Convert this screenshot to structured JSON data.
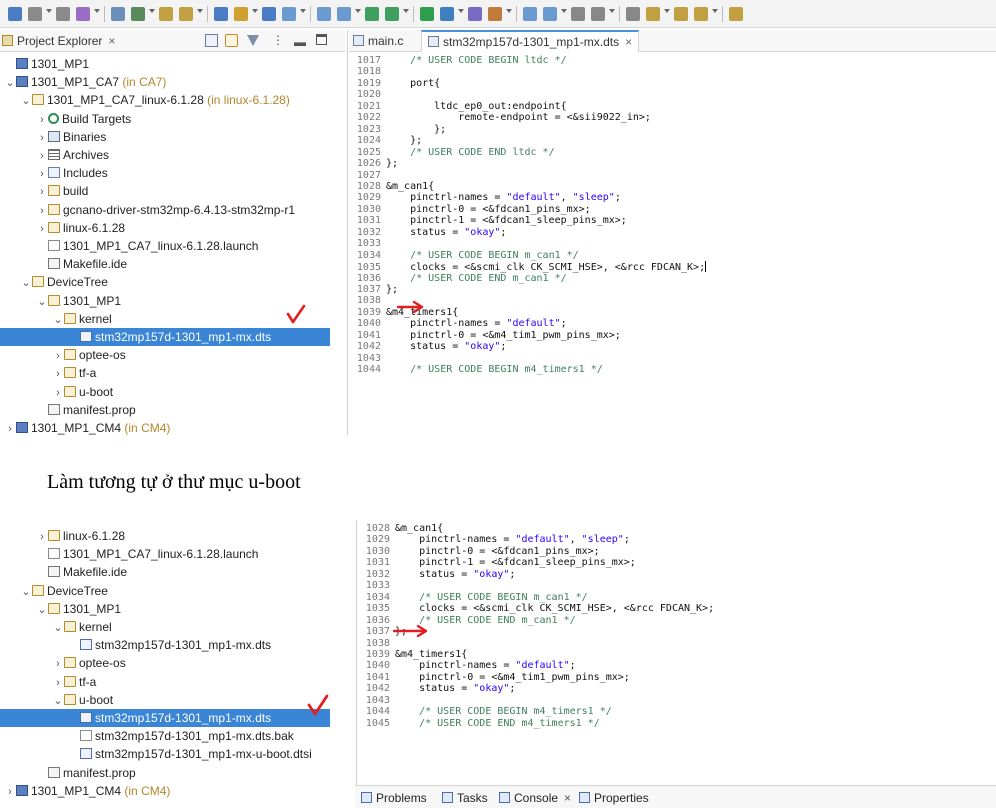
{
  "toolbar": {
    "buttons": [
      "new-icon",
      "save-icon",
      "save-all-icon",
      "debug-icon",
      "tools-icon",
      "build-icon",
      "back-icon",
      "forward-icon",
      "search-icon",
      "debug-run-icon",
      "target-icon",
      "new-project-icon",
      "new-file-icon",
      "new-class-icon",
      "refresh-icon",
      "bug-icon",
      "run-icon",
      "tools-run-icon",
      "external-icon",
      "pen-icon",
      "open-type-icon",
      "palette-icon",
      "format-icon",
      "next-annotation-icon",
      "prev-annotation-icon",
      "back-nav-icon",
      "forward-nav-icon",
      "history-back-icon",
      "history-fwd-icon"
    ]
  },
  "top": {
    "explorer": {
      "tab_label": "Project Explorer",
      "rows": [
        {
          "indent": 0,
          "twisty": "",
          "icon": "ico-project",
          "label": "1301_MP1",
          "suffix": ""
        },
        {
          "indent": 0,
          "twisty": "v",
          "icon": "ico-project",
          "label": "1301_MP1_CA7",
          "suffix": " (in CA7)"
        },
        {
          "indent": 1,
          "twisty": "v",
          "icon": "ico-folder",
          "label": "1301_MP1_CA7_linux-6.1.28",
          "suffix": " (in linux-6.1.28)"
        },
        {
          "indent": 2,
          "twisty": ">",
          "icon": "ico-target",
          "label": "Build Targets",
          "suffix": ""
        },
        {
          "indent": 2,
          "twisty": ">",
          "icon": "ico-bin",
          "label": "Binaries",
          "suffix": ""
        },
        {
          "indent": 2,
          "twisty": ">",
          "icon": "ico-arch",
          "label": "Archives",
          "suffix": ""
        },
        {
          "indent": 2,
          "twisty": ">",
          "icon": "ico-inc",
          "label": "Includes",
          "suffix": ""
        },
        {
          "indent": 2,
          "twisty": ">",
          "icon": "ico-folder",
          "label": "build",
          "suffix": ""
        },
        {
          "indent": 2,
          "twisty": ">",
          "icon": "ico-folder",
          "label": "gcnano-driver-stm32mp-6.4.13-stm32mp-r1",
          "suffix": ""
        },
        {
          "indent": 2,
          "twisty": ">",
          "icon": "ico-folder",
          "label": "linux-6.1.28",
          "suffix": ""
        },
        {
          "indent": 2,
          "twisty": "",
          "icon": "ico-file",
          "label": "1301_MP1_CA7_linux-6.1.28.launch",
          "suffix": ""
        },
        {
          "indent": 2,
          "twisty": "",
          "icon": "ico-mk",
          "label": "Makefile.ide",
          "suffix": ""
        },
        {
          "indent": 1,
          "twisty": "v",
          "icon": "ico-folder",
          "label": "DeviceTree",
          "suffix": ""
        },
        {
          "indent": 2,
          "twisty": "v",
          "icon": "ico-folder",
          "label": "1301_MP1",
          "suffix": ""
        },
        {
          "indent": 3,
          "twisty": "v",
          "icon": "ico-folder",
          "label": "kernel",
          "suffix": ""
        },
        {
          "indent": 4,
          "twisty": "",
          "icon": "ico-dts",
          "label": "stm32mp157d-1301_mp1-mx.dts",
          "suffix": "",
          "selected": true
        },
        {
          "indent": 3,
          "twisty": ">",
          "icon": "ico-folder",
          "label": "optee-os",
          "suffix": ""
        },
        {
          "indent": 3,
          "twisty": ">",
          "icon": "ico-folder",
          "label": "tf-a",
          "suffix": ""
        },
        {
          "indent": 3,
          "twisty": ">",
          "icon": "ico-folder",
          "label": "u-boot",
          "suffix": ""
        },
        {
          "indent": 2,
          "twisty": "",
          "icon": "ico-mk",
          "label": "manifest.prop",
          "suffix": ""
        },
        {
          "indent": 0,
          "twisty": ">",
          "icon": "ico-project",
          "label": "1301_MP1_CM4",
          "suffix": " (in CM4)"
        }
      ]
    },
    "editor": {
      "tabs": [
        {
          "label": "main.c",
          "active": false
        },
        {
          "label": "stm32mp157d-1301_mp1-mx.dts",
          "active": true
        }
      ],
      "lines": [
        {
          "n": "1017",
          "segs": [
            {
              "t": "    "
            },
            {
              "t": "/* USER CODE BEGIN ltdc */",
              "c": "cm"
            }
          ]
        },
        {
          "n": "1018",
          "segs": []
        },
        {
          "n": "1019",
          "segs": [
            {
              "t": "    port{"
            }
          ]
        },
        {
          "n": "1020",
          "segs": []
        },
        {
          "n": "1021",
          "segs": [
            {
              "t": "        ltdc_ep0_out:endpoint{"
            }
          ]
        },
        {
          "n": "1022",
          "segs": [
            {
              "t": "            remote-endpoint = <&sii9022_in>;"
            }
          ]
        },
        {
          "n": "1023",
          "segs": [
            {
              "t": "        };"
            }
          ]
        },
        {
          "n": "1024",
          "segs": [
            {
              "t": "    };"
            }
          ]
        },
        {
          "n": "1025",
          "segs": [
            {
              "t": "    "
            },
            {
              "t": "/* USER CODE END ltdc */",
              "c": "cm"
            }
          ]
        },
        {
          "n": "1026",
          "segs": [
            {
              "t": "};"
            }
          ]
        },
        {
          "n": "1027",
          "segs": []
        },
        {
          "n": "1028",
          "segs": [
            {
              "t": "&m_can1{"
            }
          ]
        },
        {
          "n": "1029",
          "segs": [
            {
              "t": "    pinctrl-names = "
            },
            {
              "t": "\"default\"",
              "c": "st"
            },
            {
              "t": ", "
            },
            {
              "t": "\"sleep\"",
              "c": "st"
            },
            {
              "t": ";"
            }
          ]
        },
        {
          "n": "1030",
          "segs": [
            {
              "t": "    pinctrl-0 = <&fdcan1_pins_mx>;"
            }
          ]
        },
        {
          "n": "1031",
          "segs": [
            {
              "t": "    pinctrl-1 = <&fdcan1_sleep_pins_mx>;"
            }
          ]
        },
        {
          "n": "1032",
          "segs": [
            {
              "t": "    status = "
            },
            {
              "t": "\"okay\"",
              "c": "st"
            },
            {
              "t": ";"
            }
          ]
        },
        {
          "n": "1033",
          "segs": []
        },
        {
          "n": "1034",
          "segs": [
            {
              "t": "    "
            },
            {
              "t": "/* USER CODE BEGIN m_can1 */",
              "c": "cm"
            }
          ]
        },
        {
          "n": "1035",
          "segs": [
            {
              "t": "    clocks = <&scmi_clk CK_SCMI_HSE>, <&rcc FDCAN_K>;"
            }
          ],
          "caret": true
        },
        {
          "n": "1036",
          "segs": [
            {
              "t": "    "
            },
            {
              "t": "/* USER CODE END m_can1 */",
              "c": "cm"
            }
          ]
        },
        {
          "n": "1037",
          "segs": [
            {
              "t": "};"
            }
          ]
        },
        {
          "n": "1038",
          "segs": []
        },
        {
          "n": "1039",
          "segs": [
            {
              "t": "&m4_timers1{"
            }
          ]
        },
        {
          "n": "1040",
          "segs": [
            {
              "t": "    pinctrl-names = "
            },
            {
              "t": "\"default\"",
              "c": "st"
            },
            {
              "t": ";"
            }
          ]
        },
        {
          "n": "1041",
          "segs": [
            {
              "t": "    pinctrl-0 = <&m4_tim1_pwm_pins_mx>;"
            }
          ]
        },
        {
          "n": "1042",
          "segs": [
            {
              "t": "    status = "
            },
            {
              "t": "\"okay\"",
              "c": "st"
            },
            {
              "t": ";"
            }
          ]
        },
        {
          "n": "1043",
          "segs": []
        },
        {
          "n": "1044",
          "segs": [
            {
              "t": "    "
            },
            {
              "t": "/* USER CODE BEGIN m4_timers1 */",
              "c": "cm"
            }
          ]
        }
      ]
    }
  },
  "caption": "Làm tương tự ở thư mục u-boot",
  "bottom": {
    "explorer": {
      "rows": [
        {
          "indent": 2,
          "twisty": ">",
          "icon": "ico-folder",
          "label": "linux-6.1.28",
          "suffix": ""
        },
        {
          "indent": 2,
          "twisty": "",
          "icon": "ico-file",
          "label": "1301_MP1_CA7_linux-6.1.28.launch",
          "suffix": ""
        },
        {
          "indent": 2,
          "twisty": "",
          "icon": "ico-mk",
          "label": "Makefile.ide",
          "suffix": ""
        },
        {
          "indent": 1,
          "twisty": "v",
          "icon": "ico-folder",
          "label": "DeviceTree",
          "suffix": ""
        },
        {
          "indent": 2,
          "twisty": "v",
          "icon": "ico-folder",
          "label": "1301_MP1",
          "suffix": ""
        },
        {
          "indent": 3,
          "twisty": "v",
          "icon": "ico-folder",
          "label": "kernel",
          "suffix": ""
        },
        {
          "indent": 4,
          "twisty": "",
          "icon": "ico-dts",
          "label": "stm32mp157d-1301_mp1-mx.dts",
          "suffix": ""
        },
        {
          "indent": 3,
          "twisty": ">",
          "icon": "ico-folder",
          "label": "optee-os",
          "suffix": ""
        },
        {
          "indent": 3,
          "twisty": ">",
          "icon": "ico-folder",
          "label": "tf-a",
          "suffix": ""
        },
        {
          "indent": 3,
          "twisty": "v",
          "icon": "ico-folder",
          "label": "u-boot",
          "suffix": ""
        },
        {
          "indent": 4,
          "twisty": "",
          "icon": "ico-dts",
          "label": "stm32mp157d-1301_mp1-mx.dts",
          "suffix": "",
          "selected": true
        },
        {
          "indent": 4,
          "twisty": "",
          "icon": "ico-file",
          "label": "stm32mp157d-1301_mp1-mx.dts.bak",
          "suffix": ""
        },
        {
          "indent": 4,
          "twisty": "",
          "icon": "ico-dts",
          "label": "stm32mp157d-1301_mp1-mx-u-boot.dtsi",
          "suffix": ""
        },
        {
          "indent": 2,
          "twisty": "",
          "icon": "ico-mk",
          "label": "manifest.prop",
          "suffix": ""
        },
        {
          "indent": 0,
          "twisty": ">",
          "icon": "ico-project",
          "label": "1301_MP1_CM4",
          "suffix": " (in CM4)"
        }
      ]
    },
    "editor": {
      "lines": [
        {
          "n": "1028",
          "segs": [
            {
              "t": "&m_can1{"
            }
          ]
        },
        {
          "n": "1029",
          "segs": [
            {
              "t": "    pinctrl-names = "
            },
            {
              "t": "\"default\"",
              "c": "st"
            },
            {
              "t": ", "
            },
            {
              "t": "\"sleep\"",
              "c": "st"
            },
            {
              "t": ";"
            }
          ]
        },
        {
          "n": "1030",
          "segs": [
            {
              "t": "    pinctrl-0 = <&fdcan1_pins_mx>;"
            }
          ]
        },
        {
          "n": "1031",
          "segs": [
            {
              "t": "    pinctrl-1 = <&fdcan1_sleep_pins_mx>;"
            }
          ]
        },
        {
          "n": "1032",
          "segs": [
            {
              "t": "    status = "
            },
            {
              "t": "\"okay\"",
              "c": "st"
            },
            {
              "t": ";"
            }
          ]
        },
        {
          "n": "1033",
          "segs": []
        },
        {
          "n": "1034",
          "segs": [
            {
              "t": "    "
            },
            {
              "t": "/* USER CODE BEGIN m_can1 */",
              "c": "cm"
            }
          ]
        },
        {
          "n": "1035",
          "segs": [
            {
              "t": "    clocks = <&scmi_clk CK_SCMI_HSE>, <&rcc FDCAN_K>;"
            }
          ]
        },
        {
          "n": "1036",
          "segs": [
            {
              "t": "    "
            },
            {
              "t": "/* USER CODE END m_can1 */",
              "c": "cm"
            }
          ]
        },
        {
          "n": "1037",
          "segs": [
            {
              "t": "};"
            }
          ]
        },
        {
          "n": "1038",
          "segs": []
        },
        {
          "n": "1039",
          "segs": [
            {
              "t": "&m4_timers1{"
            }
          ]
        },
        {
          "n": "1040",
          "segs": [
            {
              "t": "    pinctrl-names = "
            },
            {
              "t": "\"default\"",
              "c": "st"
            },
            {
              "t": ";"
            }
          ]
        },
        {
          "n": "1041",
          "segs": [
            {
              "t": "    pinctrl-0 = <&m4_tim1_pwm_pins_mx>;"
            }
          ]
        },
        {
          "n": "1042",
          "segs": [
            {
              "t": "    status = "
            },
            {
              "t": "\"okay\"",
              "c": "st"
            },
            {
              "t": ";"
            }
          ]
        },
        {
          "n": "1043",
          "segs": []
        },
        {
          "n": "1044",
          "segs": [
            {
              "t": "    "
            },
            {
              "t": "/* USER CODE BEGIN m4_timers1 */",
              "c": "cm"
            }
          ]
        },
        {
          "n": "1045",
          "segs": [
            {
              "t": "    "
            },
            {
              "t": "/* USER CODE END m4_timers1 */",
              "c": "cm"
            }
          ]
        }
      ]
    },
    "views": [
      {
        "label": "Problems",
        "icon": "problems-icon"
      },
      {
        "label": "Tasks",
        "icon": "tasks-icon"
      },
      {
        "label": "Console",
        "icon": "console-icon",
        "closable": true
      },
      {
        "label": "Properties",
        "icon": "properties-icon"
      }
    ]
  },
  "colors": {
    "selection": "#3a85d6",
    "annotation_red": "#e02020",
    "comment": "#3f7f5f",
    "string": "#2a00ff"
  }
}
